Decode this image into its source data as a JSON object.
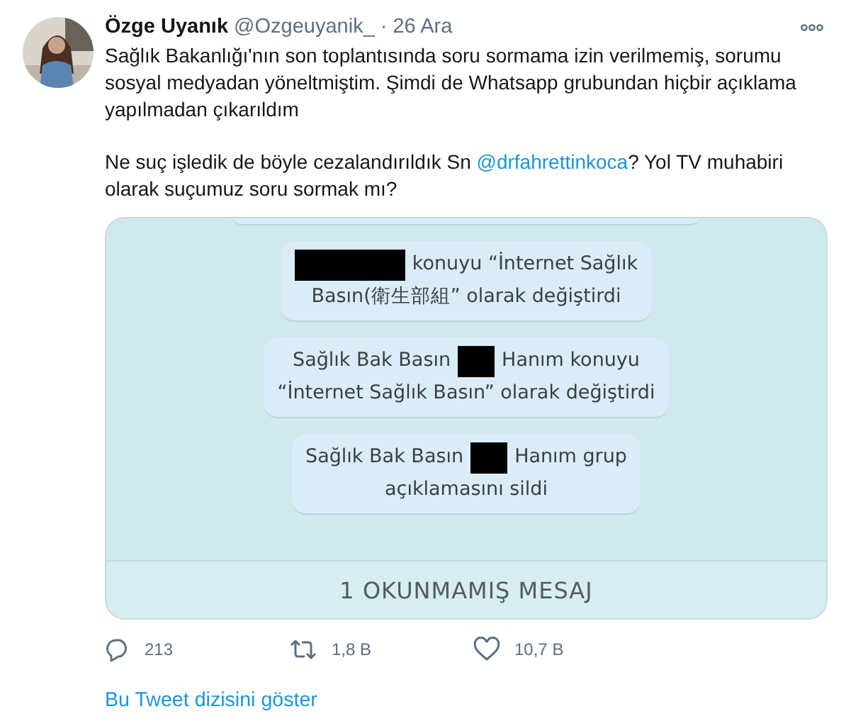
{
  "author": {
    "name": "Özge Uyanık",
    "handle": "@Ozgeuyanik_",
    "separator": "·",
    "date": "26 Ara"
  },
  "body": [
    [
      {
        "kind": "text",
        "text": "Sağlık Bakanlığı'nın son toplantısında soru sormama izin verilmemiş, sorumu sosyal medyadan yöneltmiştim. Şimdi de Whatsapp grubundan hiçbir açıklama yapılmadan çıkarıldım"
      }
    ],
    [
      {
        "kind": "text",
        "text": "Ne suç işledik de böyle cezalandırıldık Sn "
      },
      {
        "kind": "mention",
        "text": "@drfahrettinkoca"
      },
      {
        "kind": "text",
        "text": "? Yol TV muhabiri olarak suçumuz soru sormak mı?"
      }
    ]
  ],
  "chat_image": {
    "messages": [
      {
        "lines": [
          [
            {
              "kind": "redacted_long"
            },
            {
              "kind": "text",
              "text": "konuyu “İnternet Sağlık"
            }
          ],
          [
            {
              "kind": "text",
              "text": "Basın(衛生部組” olarak değiştirdi"
            }
          ]
        ]
      },
      {
        "lines": [
          [
            {
              "kind": "text",
              "text": "Sağlık Bak Basın"
            },
            {
              "kind": "redacted_short"
            },
            {
              "kind": "text",
              "text": "Hanım konuyu"
            }
          ],
          [
            {
              "kind": "text",
              "text": "“İnternet Sağlık Basın” olarak değiştirdi"
            }
          ]
        ]
      },
      {
        "lines": [
          [
            {
              "kind": "text",
              "text": "Sağlık Bak Basın"
            },
            {
              "kind": "redacted_short"
            },
            {
              "kind": "text",
              "text": "Hanım grup"
            }
          ],
          [
            {
              "kind": "text",
              "text": "açıklamasını sildi"
            }
          ]
        ]
      }
    ],
    "unread_banner": "1 OKUNMAMIŞ MESAJ"
  },
  "actions": [
    {
      "kind": "reply",
      "count": "213"
    },
    {
      "kind": "retweet",
      "count": "1,8 B"
    },
    {
      "kind": "like",
      "count": "10,7 B"
    }
  ],
  "thread_link": "Bu Tweet dizisini göster"
}
